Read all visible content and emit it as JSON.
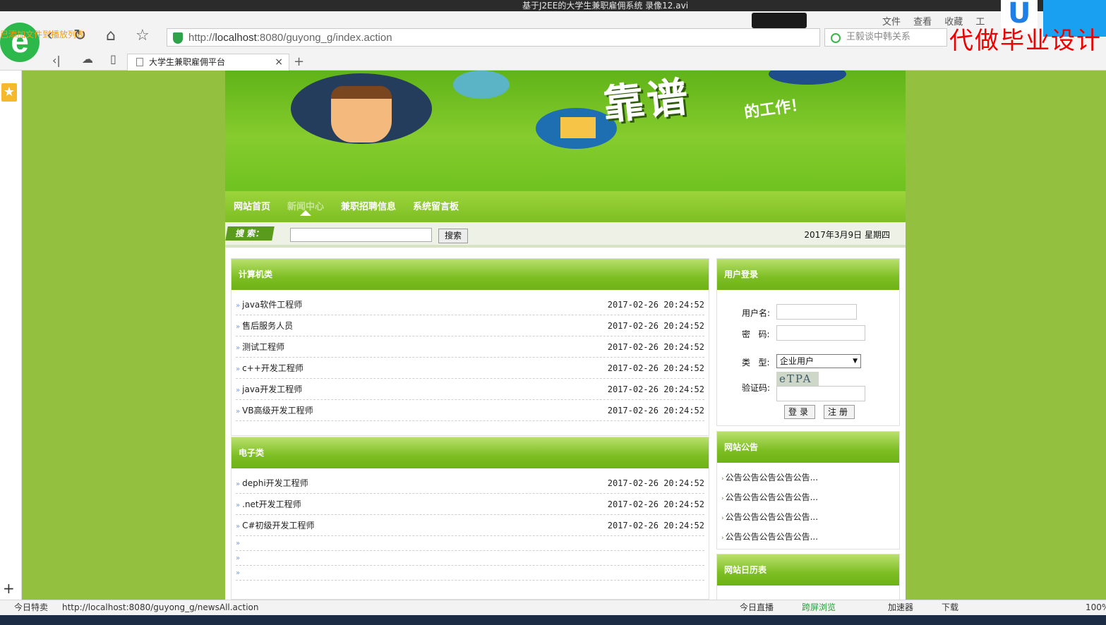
{
  "window": {
    "title": "基于J2EE的大学生兼职雇佣系统  录像12.avi"
  },
  "browser": {
    "orange_note": "已添加文件到播放列表",
    "url_prefix": "http://",
    "url_host": "localhost",
    "url_rest": ":8080/guyong_g/index.action",
    "search_placeholder": "王毅谈中韩关系",
    "menu_words": "文件 查看 收藏 工",
    "ad_text": "代做毕业设计",
    "tab_title": "大学生兼职雇佣平台",
    "tab_close": "×",
    "new_tab": "+"
  },
  "nav": {
    "items": [
      {
        "label": "网站首页"
      },
      {
        "label": "新闻中心"
      },
      {
        "label": "兼职招聘信息"
      },
      {
        "label": "系统留言板"
      }
    ]
  },
  "search": {
    "label": "搜 索：",
    "button": "搜索",
    "date": "2017年3月9日 星期四"
  },
  "banner": {
    "headline": "靠谱",
    "sub": "的工作！"
  },
  "categories": [
    {
      "title": "计算机类",
      "jobs": [
        {
          "name": "java软件工程师",
          "time": "2017-02-26 20:24:52"
        },
        {
          "name": "售后服务人员",
          "time": "2017-02-26 20:24:52"
        },
        {
          "name": "测试工程师",
          "time": "2017-02-26 20:24:52"
        },
        {
          "name": "c++开发工程师",
          "time": "2017-02-26 20:24:52"
        },
        {
          "name": "java开发工程师",
          "time": "2017-02-26 20:24:52"
        },
        {
          "name": "VB高级开发工程师",
          "time": "2017-02-26 20:24:52"
        }
      ]
    },
    {
      "title": "电子类",
      "jobs": [
        {
          "name": "dephi开发工程师",
          "time": "2017-02-26 20:24:52"
        },
        {
          "name": ".net开发工程师",
          "time": "2017-02-26 20:24:52"
        },
        {
          "name": "C#初级开发工程师",
          "time": "2017-02-26 20:24:52"
        }
      ]
    }
  ],
  "row_marker": "»",
  "login": {
    "title": "用户登录",
    "username_label": "用户名:",
    "password_label": "密   码:",
    "type_label": "类   型:",
    "type_value": "企业用户",
    "captcha_label": "验证码:",
    "captcha_text": "eTPA",
    "login_button": "登录",
    "register_button": "注册"
  },
  "notice": {
    "title": "网站公告",
    "items": [
      "公告公告公告公告公告...",
      "公告公告公告公告公告...",
      "公告公告公告公告公告...",
      "公告公告公告公告公告..."
    ]
  },
  "calendar": {
    "title": "网站日历表"
  },
  "status": {
    "left": "今日特卖",
    "url": "http://localhost:8080/guyong_g/newsAll.action",
    "live": "今日直播",
    "cross": "跨屏浏览",
    "accel": "加速器",
    "download": "下载",
    "zoom": "100%"
  }
}
